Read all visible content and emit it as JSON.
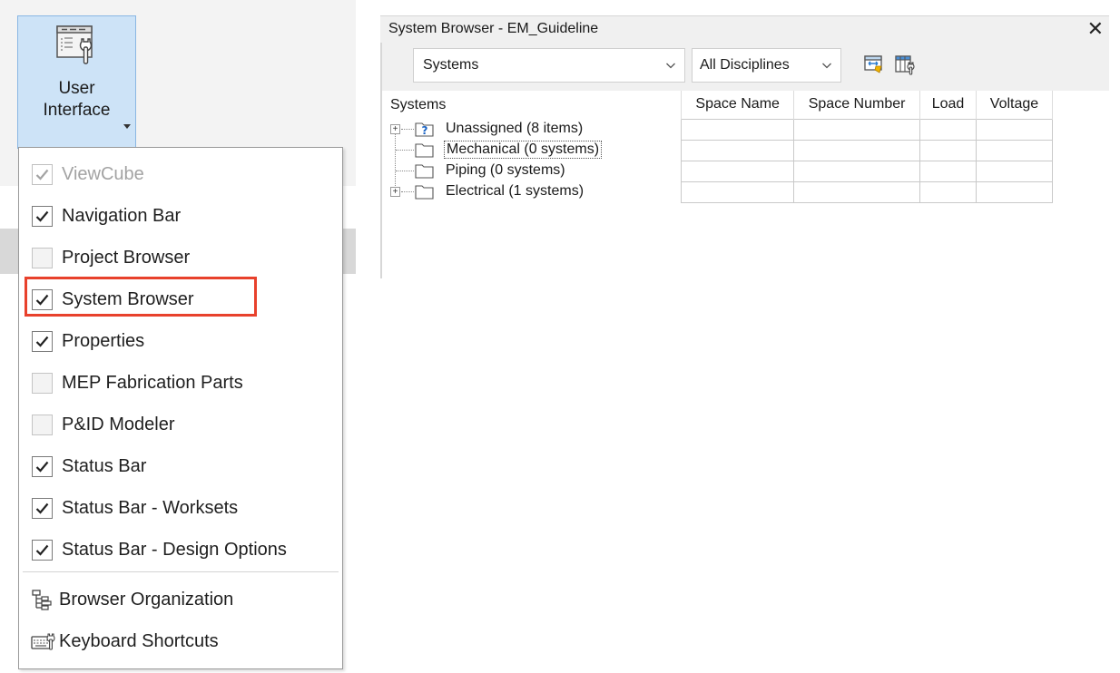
{
  "ribbon": {
    "button_line1": "User",
    "button_line2": "Interface"
  },
  "menu": {
    "items": [
      {
        "label": "ViewCube",
        "checked": true,
        "disabled": true
      },
      {
        "label": "Navigation Bar",
        "checked": true
      },
      {
        "label": "Project Browser",
        "checked": false
      },
      {
        "label": "System Browser",
        "checked": true,
        "highlighted": true
      },
      {
        "label": "Properties",
        "checked": true
      },
      {
        "label": "MEP Fabrication Parts",
        "checked": false
      },
      {
        "label": "P&ID Modeler",
        "checked": false
      },
      {
        "label": "Status Bar",
        "checked": true
      },
      {
        "label": "Status Bar - Worksets",
        "checked": true
      },
      {
        "label": "Status Bar - Design Options",
        "checked": true
      }
    ],
    "actions": [
      {
        "label": "Browser Organization",
        "icon": "tree-hierarchy-icon"
      },
      {
        "label": "Keyboard Shortcuts",
        "icon": "keyboard-icon"
      }
    ],
    "highlight_color": "#e8412c"
  },
  "system_browser": {
    "title": "System Browser - EM_Guideline",
    "close_glyph": "✕",
    "view_dropdown": "Systems",
    "discipline_dropdown": "All Disciplines",
    "columns": [
      "Systems",
      "Space Name",
      "Space Number",
      "Load",
      "Voltage"
    ],
    "rows": [
      {
        "label": "Unassigned (8 items)",
        "expandable": true,
        "icon": "unassigned-folder-icon"
      },
      {
        "label": "Mechanical (0 systems)",
        "expandable": false,
        "icon": "folder-icon"
      },
      {
        "label": "Piping (0 systems)",
        "expandable": false,
        "icon": "folder-icon"
      },
      {
        "label": "Electrical (1 systems)",
        "expandable": true,
        "icon": "folder-icon"
      }
    ]
  }
}
